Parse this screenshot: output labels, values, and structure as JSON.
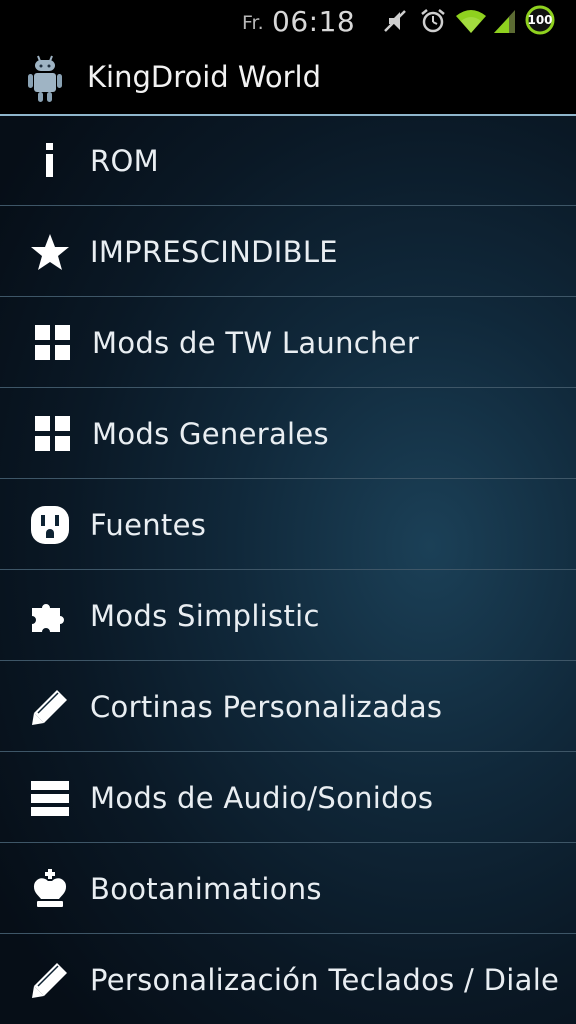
{
  "status_bar": {
    "day": "Fr.",
    "time": "06:18",
    "battery": "100",
    "icons": [
      "mute-icon",
      "alarm-icon",
      "wifi-icon",
      "signal-icon",
      "battery-icon"
    ]
  },
  "app": {
    "title": "KingDroid World",
    "icon": "android-robot-icon"
  },
  "menu": {
    "items": [
      {
        "label": "ROM",
        "icon": "info-icon"
      },
      {
        "label": "IMPRESCINDIBLE",
        "icon": "star-icon"
      },
      {
        "label": "Mods de TW Launcher",
        "icon": "grid-icon"
      },
      {
        "label": "Mods Generales",
        "icon": "grid-icon"
      },
      {
        "label": "Fuentes",
        "icon": "power-outlet-icon"
      },
      {
        "label": "Mods Simplistic",
        "icon": "puzzle-icon"
      },
      {
        "label": "Cortinas Personalizadas",
        "icon": "pencil-icon"
      },
      {
        "label": "Mods de Audio/Sonidos",
        "icon": "list-icon"
      },
      {
        "label": "Bootanimations",
        "icon": "chess-king-icon"
      },
      {
        "label": "Personalización Teclados / Diale",
        "icon": "pencil-icon"
      }
    ]
  },
  "colors": {
    "background": "#000000",
    "drawer_center": "#1b4057",
    "divider": "#3e5667",
    "accent_line": "#8fb6cc",
    "battery_ring": "#8fd11f",
    "wifi": "#8fd11f"
  }
}
